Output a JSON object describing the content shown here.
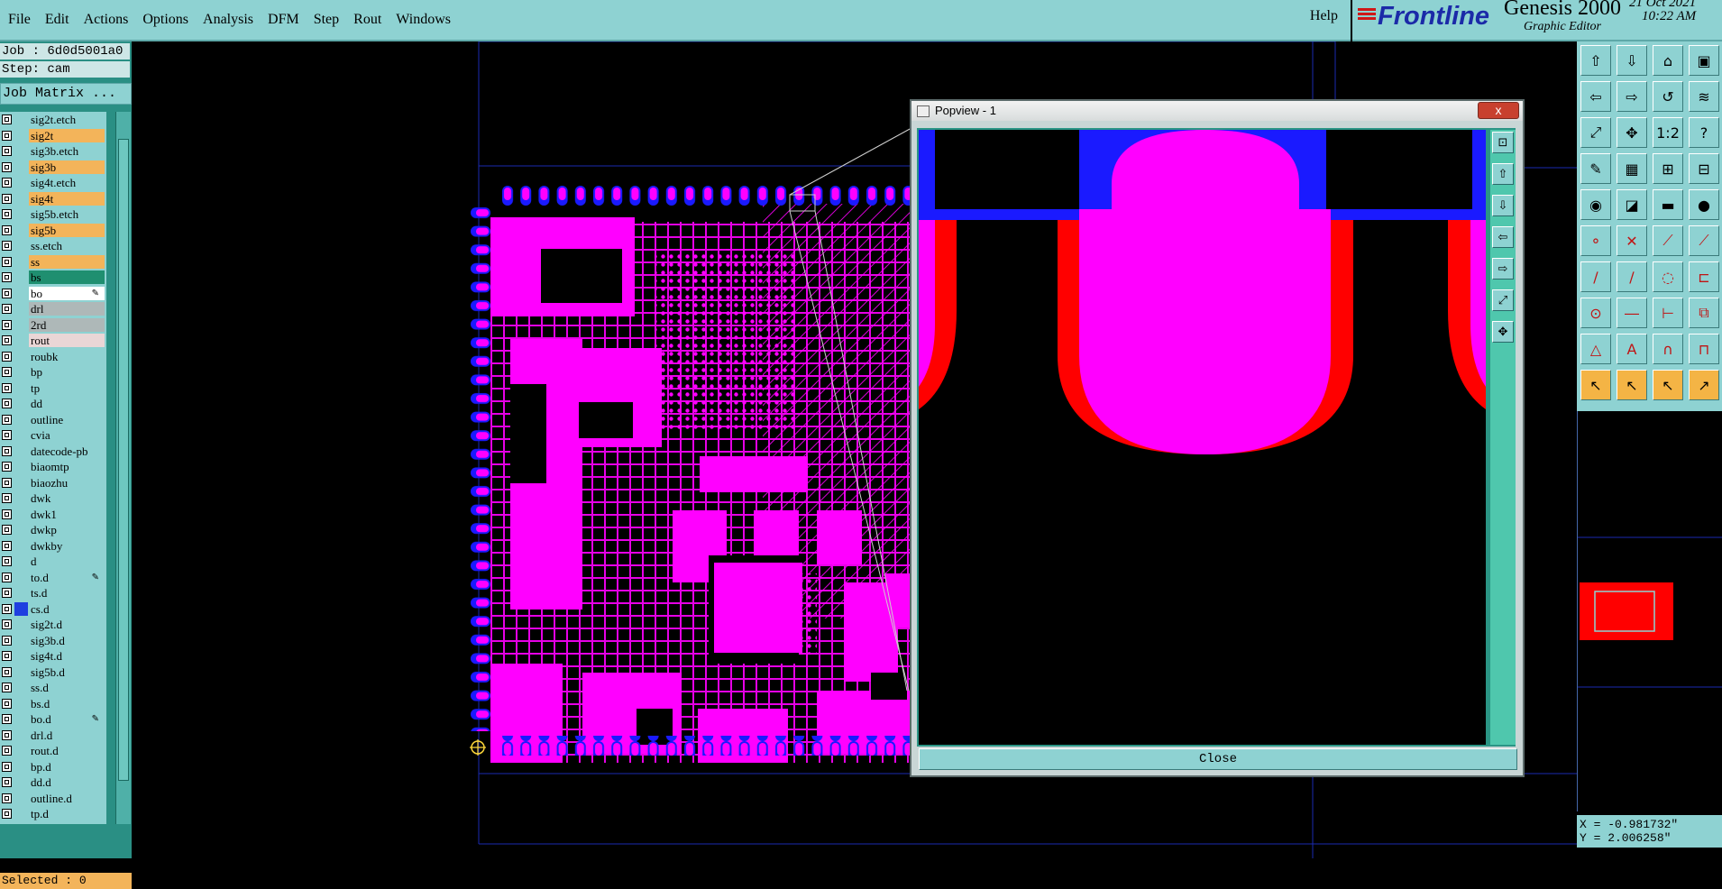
{
  "menu": {
    "items": [
      "File",
      "Edit",
      "Actions",
      "Options",
      "Analysis",
      "DFM",
      "Step",
      "Rout",
      "Windows"
    ],
    "help": "Help"
  },
  "brand": {
    "logo": "Frontline",
    "title": "Genesis 2000",
    "subtitle": "Graphic Editor",
    "date": "21 Oct 2021",
    "time": "10:22 AM"
  },
  "job": {
    "job_line": "Job : 6d0d5001a0",
    "step_line": "Step: cam",
    "matrix_button": "Job Matrix ..."
  },
  "layers": [
    {
      "name": "sig2t.etch",
      "bg": "#8ed2d2"
    },
    {
      "name": "sig2t",
      "bg": "#f3b45a"
    },
    {
      "name": "sig3b.etch",
      "bg": "#8ed2d2"
    },
    {
      "name": "sig3b",
      "bg": "#f3b45a"
    },
    {
      "name": "sig4t.etch",
      "bg": "#8ed2d2"
    },
    {
      "name": "sig4t",
      "bg": "#f3b45a"
    },
    {
      "name": "sig5b.etch",
      "bg": "#8ed2d2"
    },
    {
      "name": "sig5b",
      "bg": "#f3b45a"
    },
    {
      "name": "ss.etch",
      "bg": "#8ed2d2"
    },
    {
      "name": "ss",
      "bg": "#f3b45a"
    },
    {
      "name": "bs",
      "bg": "#1f8f70"
    },
    {
      "name": "bo",
      "bg": "#ffffff",
      "pen": true
    },
    {
      "name": "drl",
      "bg": "#aeb8b8"
    },
    {
      "name": "2rd",
      "bg": "#aeb8b8"
    },
    {
      "name": "rout",
      "bg": "#ead6d6"
    },
    {
      "name": "roubk",
      "bg": "#8ed2d2"
    },
    {
      "name": "bp",
      "bg": "#8ed2d2"
    },
    {
      "name": "tp",
      "bg": "#8ed2d2"
    },
    {
      "name": "dd",
      "bg": "#8ed2d2"
    },
    {
      "name": "outline",
      "bg": "#8ed2d2"
    },
    {
      "name": "cvia",
      "bg": "#8ed2d2"
    },
    {
      "name": "datecode-pb",
      "bg": "#8ed2d2"
    },
    {
      "name": "biaomtp",
      "bg": "#8ed2d2"
    },
    {
      "name": "biaozhu",
      "bg": "#8ed2d2"
    },
    {
      "name": "dwk",
      "bg": "#8ed2d2"
    },
    {
      "name": "dwk1",
      "bg": "#8ed2d2"
    },
    {
      "name": "dwkp",
      "bg": "#8ed2d2"
    },
    {
      "name": "dwkby",
      "bg": "#8ed2d2"
    },
    {
      "name": "d",
      "bg": "#8ed2d2"
    },
    {
      "name": "to.d",
      "bg": "#8ed2d2",
      "pen": true
    },
    {
      "name": "ts.d",
      "bg": "#8ed2d2"
    },
    {
      "name": "cs.d",
      "bg": "#8ed2d2",
      "swatch": "#1f3fe0"
    },
    {
      "name": "sig2t.d",
      "bg": "#8ed2d2"
    },
    {
      "name": "sig3b.d",
      "bg": "#8ed2d2"
    },
    {
      "name": "sig4t.d",
      "bg": "#8ed2d2"
    },
    {
      "name": "sig5b.d",
      "bg": "#8ed2d2"
    },
    {
      "name": "ss.d",
      "bg": "#8ed2d2"
    },
    {
      "name": "bs.d",
      "bg": "#8ed2d2"
    },
    {
      "name": "bo.d",
      "bg": "#8ed2d2",
      "pen": true
    },
    {
      "name": "drl.d",
      "bg": "#8ed2d2"
    },
    {
      "name": "rout.d",
      "bg": "#8ed2d2"
    },
    {
      "name": "bp.d",
      "bg": "#8ed2d2"
    },
    {
      "name": "dd.d",
      "bg": "#8ed2d2"
    },
    {
      "name": "outline.d",
      "bg": "#8ed2d2"
    },
    {
      "name": "tp.d",
      "bg": "#8ed2d2"
    }
  ],
  "status": {
    "selected": "Selected : 0",
    "x": "X = -0.981732\"",
    "y": "Y = 2.006258\""
  },
  "popview": {
    "title": "Popview - 1",
    "close_label": "Close",
    "close_x": "x"
  },
  "colors": {
    "copper": "#ff00ff",
    "pad_blue": "#1a1aff",
    "clearance_red": "#ff0000",
    "ui_teal": "#8ed2d2",
    "ui_yellow": "#f3b45a"
  }
}
